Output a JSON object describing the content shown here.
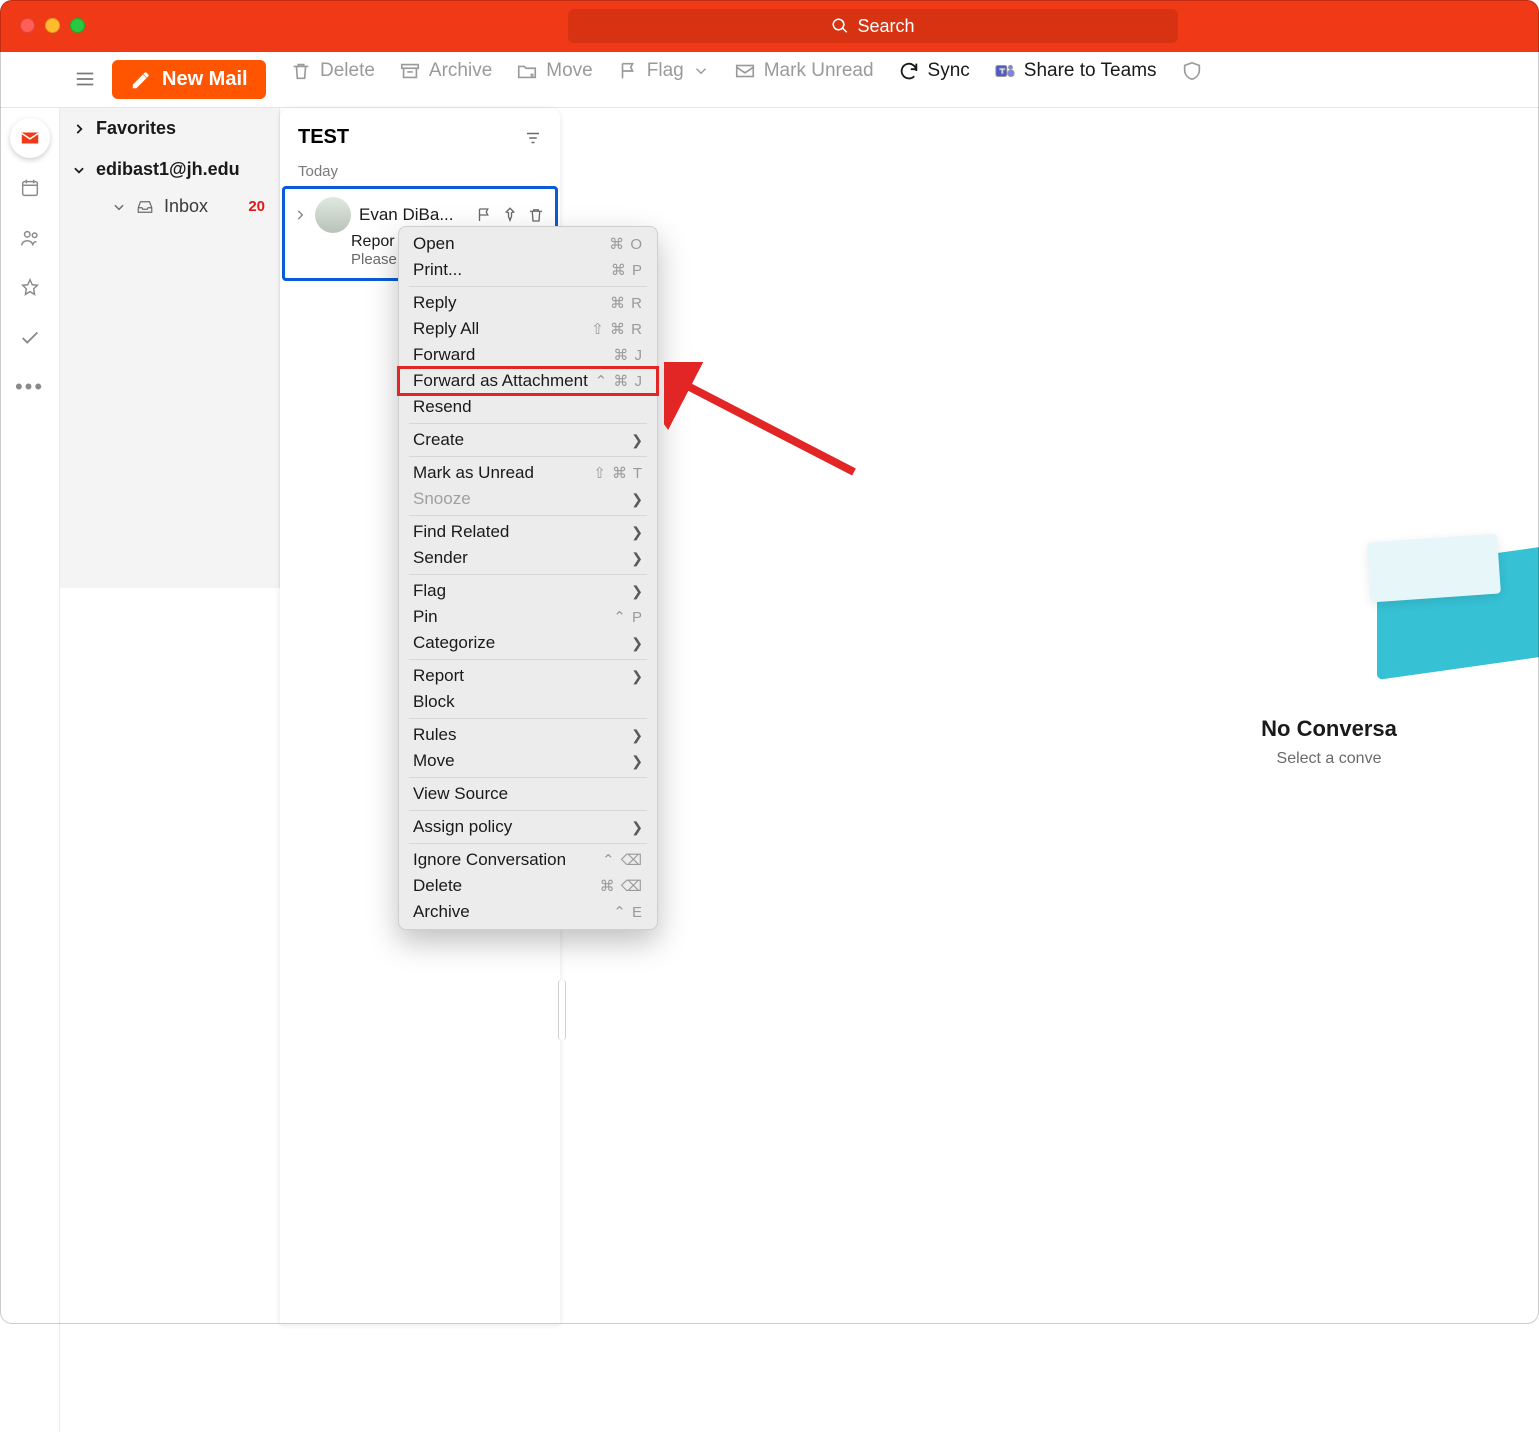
{
  "app": {
    "brand_color": "#f03a17",
    "search_placeholder": "Search"
  },
  "toolbar": {
    "new_mail": "New Mail",
    "delete": "Delete",
    "archive": "Archive",
    "move": "Move",
    "flag": "Flag",
    "mark_unread": "Mark Unread",
    "sync": "Sync",
    "share_teams": "Share to Teams"
  },
  "folders": {
    "favorites": "Favorites",
    "account": "edibast1@jh.edu",
    "inbox": "Inbox",
    "inbox_unread": "20"
  },
  "list": {
    "folder_title": "TEST",
    "date_sep": "Today",
    "message": {
      "sender": "Evan DiBa...",
      "subject": "Repor",
      "preview": "Please"
    }
  },
  "reading": {
    "empty_title": "No Conversa",
    "empty_sub": "Select a conve"
  },
  "ctx": {
    "open": {
      "label": "Open",
      "key": "⌘ O"
    },
    "print": {
      "label": "Print...",
      "key": "⌘ P"
    },
    "reply": {
      "label": "Reply",
      "key": "⌘ R"
    },
    "reply_all": {
      "label": "Reply All",
      "key": "⇧ ⌘ R"
    },
    "forward": {
      "label": "Forward",
      "key": "⌘ J"
    },
    "forward_att": {
      "label": "Forward as Attachment",
      "key": "⌃ ⌘ J"
    },
    "resend": {
      "label": "Resend"
    },
    "create": {
      "label": "Create"
    },
    "mark_unread": {
      "label": "Mark as Unread",
      "key": "⇧ ⌘ T"
    },
    "snooze": {
      "label": "Snooze"
    },
    "find_related": {
      "label": "Find Related"
    },
    "sender": {
      "label": "Sender"
    },
    "flag": {
      "label": "Flag"
    },
    "pin": {
      "label": "Pin",
      "key": "⌃ P"
    },
    "categorize": {
      "label": "Categorize"
    },
    "report": {
      "label": "Report"
    },
    "block": {
      "label": "Block"
    },
    "rules": {
      "label": "Rules"
    },
    "move": {
      "label": "Move"
    },
    "view_source": {
      "label": "View Source"
    },
    "assign_policy": {
      "label": "Assign policy"
    },
    "ignore_conv": {
      "label": "Ignore Conversation",
      "key": "⌃ ⌫"
    },
    "delete": {
      "label": "Delete",
      "key": "⌘ ⌫"
    },
    "archive": {
      "label": "Archive",
      "key": "⌃ E"
    }
  }
}
